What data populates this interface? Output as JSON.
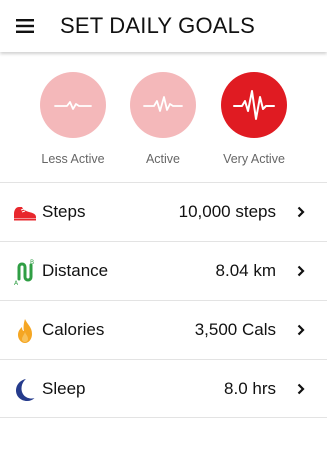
{
  "header": {
    "title": "SET DAILY GOALS",
    "menu_icon": "hamburger-menu-icon"
  },
  "activity_levels": [
    {
      "label": "Less Active",
      "selected": false,
      "icon": "heartbeat-low-icon"
    },
    {
      "label": "Active",
      "selected": false,
      "icon": "heartbeat-medium-icon"
    },
    {
      "label": "Very Active",
      "selected": true,
      "icon": "heartbeat-high-icon"
    }
  ],
  "goals": [
    {
      "label": "Steps",
      "value": "10,000 steps",
      "icon": "shoe-icon"
    },
    {
      "label": "Distance",
      "value": "8.04 km",
      "icon": "route-icon"
    },
    {
      "label": "Calories",
      "value": "3,500 Cals",
      "icon": "flame-icon"
    },
    {
      "label": "Sleep",
      "value": "8.0 hrs",
      "icon": "moon-icon"
    }
  ],
  "colors": {
    "accent": "#e01b22",
    "inactive_circle": "#f4b8ba",
    "steps_icon": "#e8272d",
    "distance_icon": "#2f9e44",
    "calories_icon": "#f5a623",
    "sleep_icon": "#253b8c"
  }
}
